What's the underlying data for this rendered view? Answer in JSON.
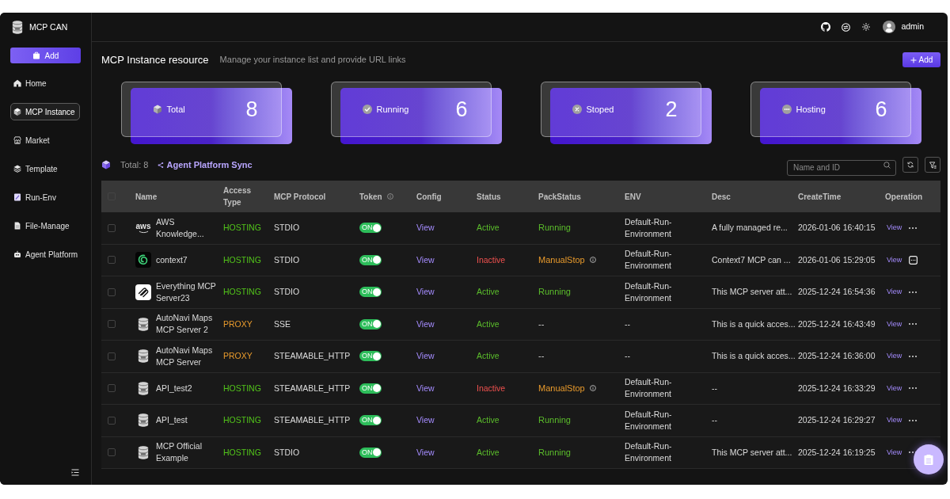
{
  "sidebar": {
    "app_name": "MCP CAN",
    "add_button": "Add",
    "items": [
      {
        "label": "Home",
        "kind": "home",
        "selected": false
      },
      {
        "label": "MCP Instance",
        "kind": "cube",
        "selected": true
      },
      {
        "label": "Market",
        "kind": "store",
        "selected": false
      },
      {
        "label": "Template",
        "kind": "layers",
        "selected": false
      },
      {
        "label": "Run-Env",
        "kind": "edit",
        "selected": false
      },
      {
        "label": "File-Manage",
        "kind": "file",
        "selected": false
      },
      {
        "label": "Agent Platform",
        "kind": "robot",
        "selected": false
      }
    ]
  },
  "header": {
    "user": "admin"
  },
  "page": {
    "title": "MCP Instance resource",
    "subtitle": "Manage your instance list and provide URL links",
    "add_button": "Add"
  },
  "stats": [
    {
      "label": "Total",
      "value": "8",
      "kind": "total"
    },
    {
      "label": "Running",
      "value": "6",
      "kind": "running"
    },
    {
      "label": "Stoped",
      "value": "2",
      "kind": "stopped"
    },
    {
      "label": "Hosting",
      "value": "6",
      "kind": "hosting"
    }
  ],
  "toolbar": {
    "total": "Total: 8",
    "sync_link": "Agent Platform Sync",
    "search": {
      "placeholder": "Name and ID"
    }
  },
  "table": {
    "select_all": {
      "checked": false
    },
    "columns": [
      {
        "label": "Name",
        "info": false
      },
      {
        "label": "Access Type",
        "info": false
      },
      {
        "label": "MCP Protocol",
        "info": false
      },
      {
        "label": "Token",
        "info": true
      },
      {
        "label": "Config",
        "info": false
      },
      {
        "label": "Status",
        "info": false
      },
      {
        "label": "PackStatus",
        "info": false
      },
      {
        "label": "ENV",
        "info": false
      },
      {
        "label": "Desc",
        "info": false
      },
      {
        "label": "CreateTime",
        "info": false
      },
      {
        "label": "Operation",
        "info": false
      }
    ],
    "rows": [
      {
        "checked": false,
        "logo": {
          "kind": "wordmark",
          "text": "aws"
        },
        "name": "AWS Knowledge...",
        "access": {
          "text": "HOSTING",
          "color": "#52c41a"
        },
        "protocol": "STDIO",
        "token": {
          "label": "ON",
          "on": true
        },
        "config_link": "View",
        "status": {
          "text": "Active",
          "active": true
        },
        "pack_status": {
          "text": "Running",
          "color": "#5bbd2b",
          "info": false
        },
        "env": "Default-Run-Environment",
        "desc": "A fully managed re...",
        "create_time": "2026-01-06 16:40:15",
        "view_link": "View",
        "more": {
          "kind": "dots"
        }
      },
      {
        "checked": false,
        "logo": {
          "kind": "spiral"
        },
        "name": "context7",
        "access": {
          "text": "HOSTING",
          "color": "#52c41a"
        },
        "protocol": "STDIO",
        "token": {
          "label": "ON",
          "on": true
        },
        "config_link": "View",
        "status": {
          "text": "Inactive",
          "active": false
        },
        "pack_status": {
          "text": "ManualStop",
          "color": "#e89a2c",
          "info": true
        },
        "env": "Default-Run-Environment",
        "desc": "Context7 MCP can ...",
        "create_time": "2026-01-06 15:29:05",
        "view_link": "View",
        "more": {
          "kind": "square"
        }
      },
      {
        "checked": false,
        "logo": {
          "kind": "ribbon"
        },
        "name": "Everything MCP Server23",
        "access": {
          "text": "HOSTING",
          "color": "#52c41a"
        },
        "protocol": "STDIO",
        "token": {
          "label": "ON",
          "on": true
        },
        "config_link": "View",
        "status": {
          "text": "Active",
          "active": true
        },
        "pack_status": {
          "text": "Running",
          "color": "#5bbd2b",
          "info": false
        },
        "env": "Default-Run-Environment",
        "desc": "This MCP server att...",
        "create_time": "2025-12-24 16:54:36",
        "view_link": "View",
        "more": {
          "kind": "dots"
        }
      },
      {
        "checked": false,
        "logo": {
          "kind": "barrel"
        },
        "name": "AutoNavi Maps MCP Server 2",
        "access": {
          "text": "PROXY",
          "color": "#e89a2c"
        },
        "protocol": "SSE",
        "token": {
          "label": "ON",
          "on": true
        },
        "config_link": "View",
        "status": {
          "text": "Active",
          "active": true
        },
        "pack_status": {
          "text": "--",
          "info": false
        },
        "env": "--",
        "desc": "This is a quick acces...",
        "create_time": "2025-12-24 16:43:49",
        "view_link": "View",
        "more": {
          "kind": "dots"
        }
      },
      {
        "checked": false,
        "logo": {
          "kind": "barrel"
        },
        "name": "AutoNavi Maps MCP Server",
        "access": {
          "text": "PROXY",
          "color": "#e89a2c"
        },
        "protocol": "STEAMABLE_HTTP",
        "token": {
          "label": "ON",
          "on": true
        },
        "config_link": "View",
        "status": {
          "text": "Active",
          "active": true
        },
        "pack_status": {
          "text": "--",
          "info": false
        },
        "env": "--",
        "desc": "This is a quick acces...",
        "create_time": "2025-12-24 16:36:00",
        "view_link": "View",
        "more": {
          "kind": "dots"
        }
      },
      {
        "checked": false,
        "logo": {
          "kind": "barrel"
        },
        "name": "API_test2",
        "access": {
          "text": "HOSTING",
          "color": "#52c41a"
        },
        "protocol": "STEAMABLE_HTTP",
        "token": {
          "label": "ON",
          "on": true
        },
        "config_link": "View",
        "status": {
          "text": "Inactive",
          "active": false
        },
        "pack_status": {
          "text": "ManualStop",
          "color": "#e89a2c",
          "info": true
        },
        "env": "Default-Run-Environment",
        "desc": "--",
        "create_time": "2025-12-24 16:33:29",
        "view_link": "View",
        "more": {
          "kind": "dots"
        }
      },
      {
        "checked": false,
        "logo": {
          "kind": "barrel"
        },
        "name": "API_test",
        "access": {
          "text": "HOSTING",
          "color": "#52c41a"
        },
        "protocol": "STEAMABLE_HTTP",
        "token": {
          "label": "ON",
          "on": true
        },
        "config_link": "View",
        "status": {
          "text": "Active",
          "active": true
        },
        "pack_status": {
          "text": "Running",
          "color": "#5bbd2b",
          "info": false
        },
        "env": "Default-Run-Environment",
        "desc": "--",
        "create_time": "2025-12-24 16:29:27",
        "view_link": "View",
        "more": {
          "kind": "dots"
        }
      },
      {
        "checked": false,
        "logo": {
          "kind": "barrel"
        },
        "name": "MCP Official Example",
        "access": {
          "text": "HOSTING",
          "color": "#52c41a"
        },
        "protocol": "STDIO",
        "token": {
          "label": "ON",
          "on": true
        },
        "config_link": "View",
        "status": {
          "text": "Active",
          "active": true
        },
        "pack_status": {
          "text": "Running",
          "color": "#5bbd2b",
          "info": false
        },
        "env": "Default-Run-Environment",
        "desc": "This MCP server att...",
        "create_time": "2025-12-24 16:19:25",
        "view_link": "View",
        "more": {
          "kind": "dots"
        }
      }
    ]
  }
}
